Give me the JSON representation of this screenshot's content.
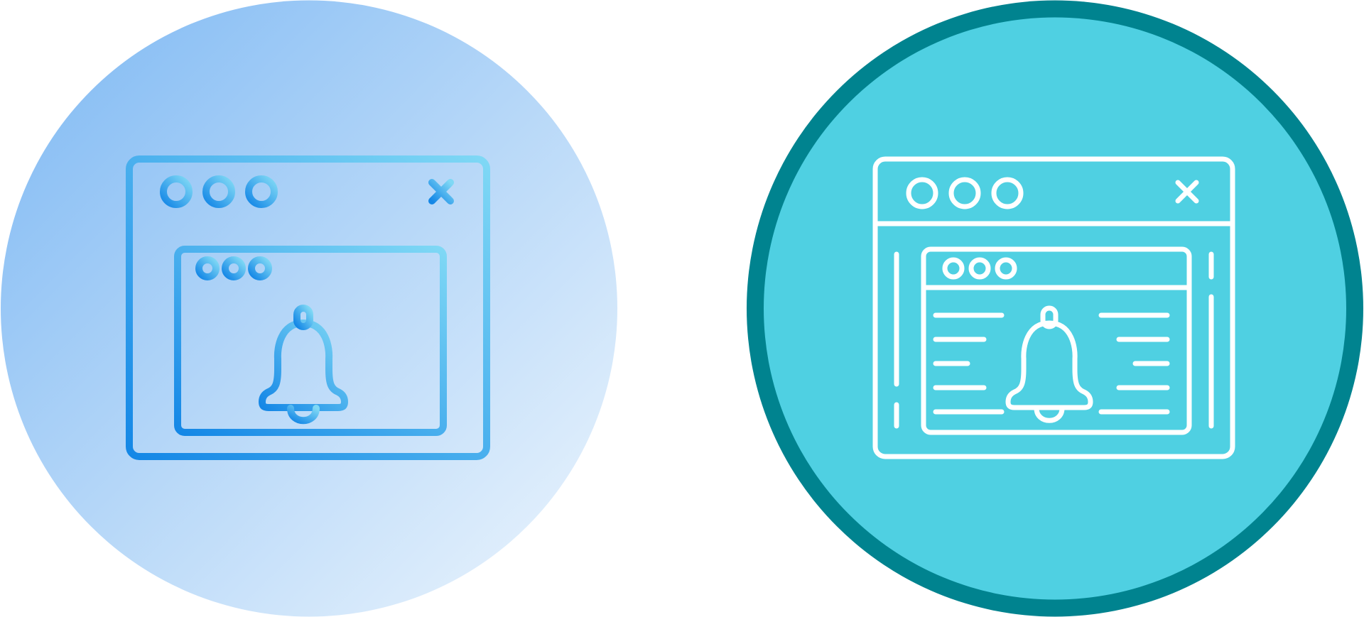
{
  "icons": [
    {
      "id": "gradient",
      "name": "browser-notification-bell-gradient",
      "style": "gradient-line",
      "colors": {
        "circle_from": "#7db8f3",
        "circle_to": "#eef6fd",
        "stroke_from": "#1487e6",
        "stroke_to": "#7fd8f5"
      }
    },
    {
      "id": "filled",
      "name": "browser-notification-bell-filled",
      "style": "filled-line",
      "colors": {
        "ring": "#00838f",
        "circle": "#4fd0e2",
        "stroke": "#ffffff"
      }
    }
  ]
}
